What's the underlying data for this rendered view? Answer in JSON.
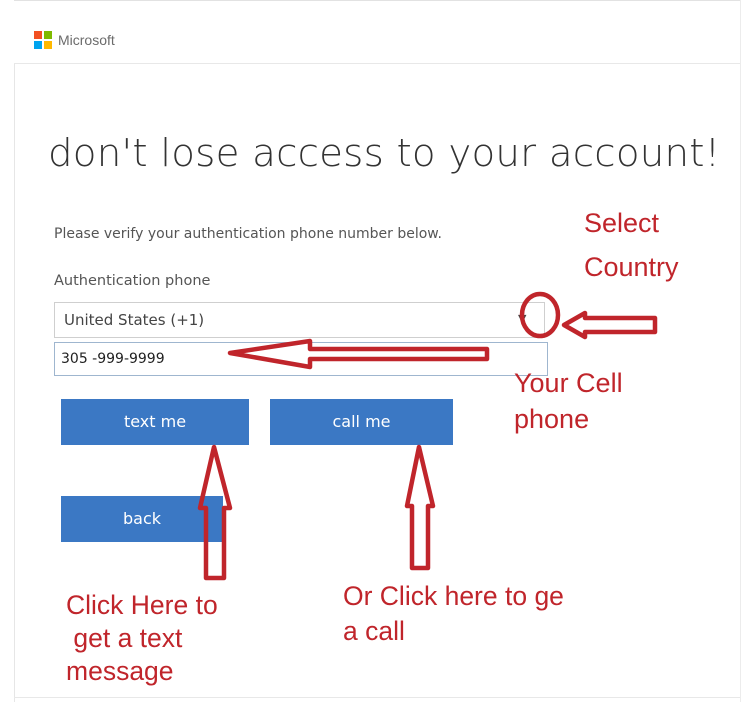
{
  "brand": {
    "name": "Microsoft",
    "logo_colors": [
      "#f25022",
      "#7fba00",
      "#00a4ef",
      "#ffb900"
    ]
  },
  "page": {
    "title": "don't lose access to your account!",
    "instructions": "Please verify your authentication phone number below.",
    "field_label": "Authentication phone"
  },
  "country_select": {
    "value": "United States (+1)",
    "arrow_icon": "triangle-down-icon"
  },
  "phone_input": {
    "value": "305 -999-9999"
  },
  "buttons": {
    "text_me": "text me",
    "call_me": "call me",
    "back": "back"
  },
  "annotations": {
    "select_country": [
      "Select",
      "Country"
    ],
    "your_cell_phone": [
      "Your Cell",
      "phone"
    ],
    "click_here_text": [
      "Click Here to",
      " get a text",
      "message"
    ],
    "click_here_call": [
      "Or Click here to ge",
      "a call"
    ]
  },
  "colors": {
    "primary_button": "#3b78c4",
    "annotation_red": "#c0252b"
  }
}
